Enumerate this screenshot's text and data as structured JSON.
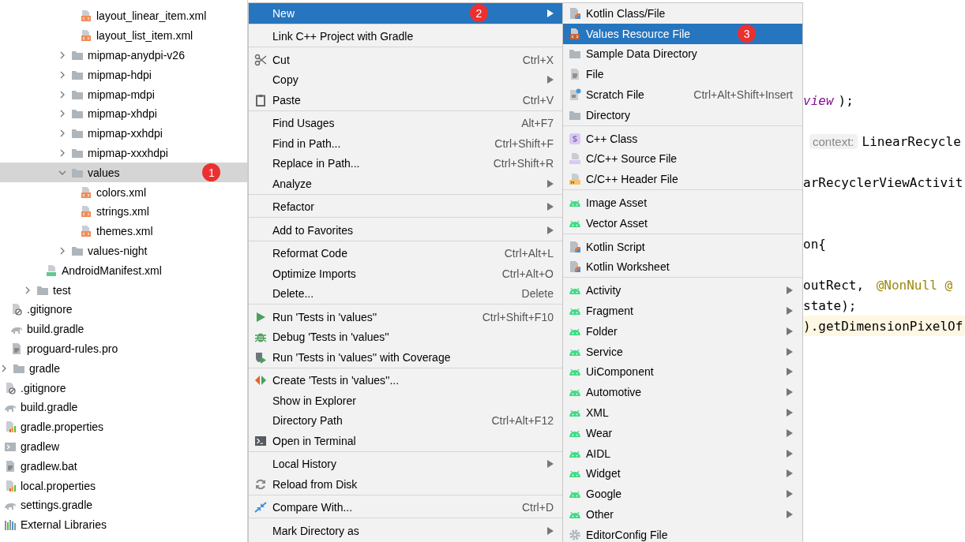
{
  "project_tree": [
    {
      "children": [
        {
          "children": [
            {
              "children": [
                {
                  "children": [
                    {
                      "children": [
                        {
                          "label": "layout_linear_item.xml",
                          "kind": "xml",
                          "selected": false
                        },
                        {
                          "label": "layout_list_item.xml",
                          "kind": "xml",
                          "selected": false
                        }
                      ]
                    },
                    {
                      "label": "mipmap-anydpi-v26",
                      "kind": "folder",
                      "expanded": false,
                      "selected": false
                    },
                    {
                      "label": "mipmap-hdpi",
                      "kind": "folder",
                      "expanded": false,
                      "selected": false
                    },
                    {
                      "label": "mipmap-mdpi",
                      "kind": "folder",
                      "expanded": false,
                      "selected": false
                    },
                    {
                      "label": "mipmap-xhdpi",
                      "kind": "folder",
                      "expanded": false,
                      "selected": false
                    },
                    {
                      "label": "mipmap-xxhdpi",
                      "kind": "folder",
                      "expanded": false,
                      "selected": false
                    },
                    {
                      "label": "mipmap-xxxhdpi",
                      "kind": "folder",
                      "expanded": false,
                      "selected": false
                    },
                    {
                      "label": "values",
                      "kind": "folder",
                      "expanded": true,
                      "selected": true,
                      "badge": "1",
                      "children": [
                        {
                          "label": "colors.xml",
                          "kind": "xml",
                          "selected": false
                        },
                        {
                          "label": "strings.xml",
                          "kind": "xml",
                          "selected": false
                        },
                        {
                          "label": "themes.xml",
                          "kind": "xml",
                          "selected": false
                        }
                      ]
                    },
                    {
                      "label": "values-night",
                      "kind": "folder",
                      "expanded": false,
                      "selected": false
                    }
                  ]
                },
                {
                  "label": "AndroidManifest.xml",
                  "kind": "manifest",
                  "selected": false
                }
              ]
            },
            {
              "label": "test",
              "kind": "folder",
              "expanded": false,
              "selected": false
            }
          ]
        },
        {
          "label": ".gitignore",
          "kind": "ignore",
          "selected": false
        },
        {
          "label": "build.gradle",
          "kind": "gradle",
          "selected": false
        },
        {
          "label": "proguard-rules.pro",
          "kind": "text",
          "selected": false
        }
      ]
    },
    {
      "label": "gradle",
      "kind": "folder",
      "expanded": false,
      "selected": false
    },
    {
      "label": ".gitignore",
      "kind": "ignore",
      "selected": false
    },
    {
      "label": "build.gradle",
      "kind": "gradle",
      "selected": false
    },
    {
      "label": "gradle.properties",
      "kind": "properties",
      "selected": false
    },
    {
      "label": "gradlew",
      "kind": "shell",
      "selected": false
    },
    {
      "label": "gradlew.bat",
      "kind": "text",
      "selected": false
    },
    {
      "label": "local.properties",
      "kind": "properties",
      "selected": false
    },
    {
      "label": "settings.gradle",
      "kind": "gradle",
      "selected": false
    },
    {
      "label": "External Libraries",
      "kind": "libraries",
      "selected": false
    }
  ],
  "editor": {
    "lines": [
      {
        "highlighted": false,
        "segments": [
          {
            "kind": "field",
            "text": "view"
          },
          {
            "kind": "plain",
            "text": ");"
          }
        ]
      },
      {
        "highlighted": false,
        "segments": [
          {
            "kind": "hint",
            "text": "context:"
          },
          {
            "kind": "plain",
            "text": "LinearRecycle"
          }
        ]
      },
      {
        "highlighted": false,
        "segments": [
          {
            "kind": "plain",
            "text": "arRecyclerViewActivit"
          }
        ]
      },
      {
        "highlighted": false,
        "segments": [
          {
            "kind": "plain",
            "text": "on{"
          }
        ]
      },
      {
        "highlighted": false,
        "segments": [
          {
            "kind": "plain",
            "text": "outRect, "
          },
          {
            "kind": "annotation",
            "text": "@NonNull @"
          }
        ]
      },
      {
        "highlighted": false,
        "segments": [
          {
            "kind": "plain",
            "text": "state);"
          }
        ]
      },
      {
        "highlighted": true,
        "segments": [
          {
            "kind": "plain",
            "text": ").getDimensionPixelOf"
          }
        ]
      }
    ]
  },
  "context_menu": {
    "items": [
      {
        "kind": "plain",
        "label": "New",
        "submenu": true,
        "selected": true,
        "badge": "2"
      },
      {
        "kind": "separator"
      },
      {
        "kind": "plain",
        "label": "Link C++ Project with Gradle",
        "submenu": false,
        "selected": false
      },
      {
        "kind": "separator"
      },
      {
        "kind": "scissors",
        "label": "Cut",
        "shortcut": "Ctrl+X",
        "submenu": false,
        "selected": false
      },
      {
        "kind": "plain",
        "label": "Copy",
        "submenu": true,
        "selected": false
      },
      {
        "kind": "clipboard",
        "label": "Paste",
        "shortcut": "Ctrl+V",
        "submenu": false,
        "selected": false
      },
      {
        "kind": "separator"
      },
      {
        "kind": "plain",
        "label": "Find Usages",
        "shortcut": "Alt+F7",
        "submenu": false,
        "selected": false
      },
      {
        "kind": "plain",
        "label": "Find in Path...",
        "shortcut": "Ctrl+Shift+F",
        "submenu": false,
        "selected": false
      },
      {
        "kind": "plain",
        "label": "Replace in Path...",
        "shortcut": "Ctrl+Shift+R",
        "submenu": false,
        "selected": false
      },
      {
        "kind": "plain",
        "label": "Analyze",
        "submenu": true,
        "selected": false
      },
      {
        "kind": "separator"
      },
      {
        "kind": "plain",
        "label": "Refactor",
        "submenu": true,
        "selected": false
      },
      {
        "kind": "separator"
      },
      {
        "kind": "plain",
        "label": "Add to Favorites",
        "submenu": true,
        "selected": false
      },
      {
        "kind": "separator"
      },
      {
        "kind": "plain",
        "label": "Reformat Code",
        "shortcut": "Ctrl+Alt+L",
        "submenu": false,
        "selected": false
      },
      {
        "kind": "plain",
        "label": "Optimize Imports",
        "shortcut": "Ctrl+Alt+O",
        "submenu": false,
        "selected": false
      },
      {
        "kind": "plain",
        "label": "Delete...",
        "shortcut": "Delete",
        "submenu": false,
        "selected": false
      },
      {
        "kind": "separator"
      },
      {
        "kind": "play",
        "label": "Run 'Tests in 'values''",
        "shortcut": "Ctrl+Shift+F10",
        "submenu": false,
        "selected": false
      },
      {
        "kind": "bug",
        "label": "Debug 'Tests in 'values''",
        "submenu": false,
        "selected": false
      },
      {
        "kind": "coverage",
        "label": "Run 'Tests in 'values'' with Coverage",
        "submenu": false,
        "selected": false
      },
      {
        "kind": "separator"
      },
      {
        "kind": "create",
        "label": "Create 'Tests in 'values''...",
        "submenu": false,
        "selected": false
      },
      {
        "kind": "plain",
        "label": "Show in Explorer",
        "submenu": false,
        "selected": false
      },
      {
        "kind": "plain",
        "label": "Directory Path",
        "shortcut": "Ctrl+Alt+F12",
        "submenu": false,
        "selected": false
      },
      {
        "kind": "terminal",
        "label": "Open in Terminal",
        "submenu": false,
        "selected": false
      },
      {
        "kind": "separator"
      },
      {
        "kind": "plain",
        "label": "Local History",
        "submenu": true,
        "selected": false
      },
      {
        "kind": "reload",
        "label": "Reload from Disk",
        "submenu": false,
        "selected": false
      },
      {
        "kind": "separator"
      },
      {
        "kind": "compare",
        "label": "Compare With...",
        "shortcut": "Ctrl+D",
        "submenu": false,
        "selected": false
      },
      {
        "kind": "separator"
      },
      {
        "kind": "plain",
        "label": "Mark Directory as",
        "submenu": true,
        "selected": false
      }
    ]
  },
  "new_submenu": {
    "items": [
      {
        "kind": "kotlin",
        "label": "Kotlin Class/File",
        "submenu": false,
        "selected": false
      },
      {
        "kind": "values",
        "label": "Values Resource File",
        "submenu": false,
        "selected": true,
        "badge": "3"
      },
      {
        "kind": "folder",
        "label": "Sample Data Directory",
        "submenu": false,
        "selected": false
      },
      {
        "kind": "file",
        "label": "File",
        "submenu": false,
        "selected": false
      },
      {
        "kind": "scratch",
        "label": "Scratch File",
        "shortcut": "Ctrl+Alt+Shift+Insert",
        "submenu": false,
        "selected": false
      },
      {
        "kind": "folder",
        "label": "Directory",
        "submenu": false,
        "selected": false
      },
      {
        "kind": "separator"
      },
      {
        "kind": "cpp-class",
        "label": "C++ Class",
        "submenu": false,
        "selected": false
      },
      {
        "kind": "cpp-source",
        "label": "C/C++ Source File",
        "submenu": false,
        "selected": false
      },
      {
        "kind": "cpp-header",
        "label": "C/C++ Header File",
        "submenu": false,
        "selected": false
      },
      {
        "kind": "separator"
      },
      {
        "kind": "android",
        "label": "Image Asset",
        "submenu": false,
        "selected": false
      },
      {
        "kind": "android",
        "label": "Vector Asset",
        "submenu": false,
        "selected": false
      },
      {
        "kind": "separator"
      },
      {
        "kind": "kotlin",
        "label": "Kotlin Script",
        "submenu": false,
        "selected": false
      },
      {
        "kind": "kotlin",
        "label": "Kotlin Worksheet",
        "submenu": false,
        "selected": false
      },
      {
        "kind": "separator"
      },
      {
        "kind": "android",
        "label": "Activity",
        "submenu": true,
        "selected": false
      },
      {
        "kind": "android",
        "label": "Fragment",
        "submenu": true,
        "selected": false
      },
      {
        "kind": "android",
        "label": "Folder",
        "submenu": true,
        "selected": false
      },
      {
        "kind": "android",
        "label": "Service",
        "submenu": true,
        "selected": false
      },
      {
        "kind": "android",
        "label": "UiComponent",
        "submenu": true,
        "selected": false
      },
      {
        "kind": "android",
        "label": "Automotive",
        "submenu": true,
        "selected": false
      },
      {
        "kind": "android",
        "label": "XML",
        "submenu": true,
        "selected": false
      },
      {
        "kind": "android",
        "label": "Wear",
        "submenu": true,
        "selected": false
      },
      {
        "kind": "android",
        "label": "AIDL",
        "submenu": true,
        "selected": false
      },
      {
        "kind": "android",
        "label": "Widget",
        "submenu": true,
        "selected": false
      },
      {
        "kind": "android",
        "label": "Google",
        "submenu": true,
        "selected": false
      },
      {
        "kind": "android",
        "label": "Other",
        "submenu": true,
        "selected": false
      },
      {
        "kind": "gear",
        "label": "EditorConfig File",
        "submenu": false,
        "selected": false
      }
    ]
  }
}
